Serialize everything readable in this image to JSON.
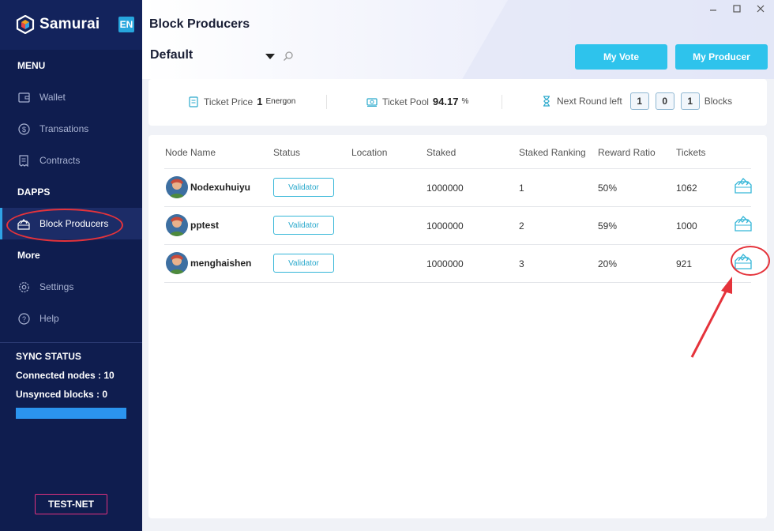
{
  "app": {
    "brand": "Samurai",
    "lang": "EN"
  },
  "sidebar": {
    "menu_title": "MENU",
    "menu": [
      {
        "label": "Wallet",
        "icon": "wallet-icon"
      },
      {
        "label": "Transations",
        "icon": "dollar-icon"
      },
      {
        "label": "Contracts",
        "icon": "contract-icon"
      }
    ],
    "dapps_title": "DAPPS",
    "dapps": [
      {
        "label": "Block Producers",
        "icon": "vote-box-icon",
        "active": true
      }
    ],
    "more_title": "More",
    "more": [
      {
        "label": "Settings",
        "icon": "gear-icon"
      },
      {
        "label": "Help",
        "icon": "help-icon"
      }
    ],
    "sync": {
      "title": "SYNC STATUS",
      "connected": "Connected nodes : ",
      "connected_val": "10",
      "unsynced": "Unsynced blocks : ",
      "unsynced_val": "0",
      "progress": 1.0
    },
    "network": "TEST-NET"
  },
  "header": {
    "title": "Block Producers",
    "selector": "Default",
    "my_vote": "My Vote",
    "my_producer": "My Producer"
  },
  "stats": {
    "ticket_price_label": "Ticket Price",
    "ticket_price_val": "1",
    "ticket_price_unit": "Energon",
    "ticket_pool_label": "Ticket Pool",
    "ticket_pool_val": "94.17",
    "ticket_pool_unit": "%",
    "next_round_label": "Next Round left",
    "next_round_digits": [
      "1",
      "0",
      "1"
    ],
    "next_round_unit": "Blocks"
  },
  "table": {
    "columns": [
      "Node Name",
      "Status",
      "Location",
      "Staked",
      "Staked Ranking",
      "Reward Ratio",
      "Tickets"
    ],
    "rows": [
      {
        "name": "Nodexuhuiyu",
        "status": "Validator",
        "location": "",
        "staked": "1000000",
        "ranking": "1",
        "reward": "50%",
        "tickets": "1062"
      },
      {
        "name": "pptest",
        "status": "Validator",
        "location": "",
        "staked": "1000000",
        "ranking": "2",
        "reward": "59%",
        "tickets": "1000"
      },
      {
        "name": "menghaishen",
        "status": "Validator",
        "location": "",
        "staked": "1000000",
        "ranking": "3",
        "reward": "20%",
        "tickets": "921"
      }
    ]
  },
  "colors": {
    "sidebar": "#0f1d4f",
    "accent": "#2ec3ec",
    "annotation": "#e5333b"
  }
}
